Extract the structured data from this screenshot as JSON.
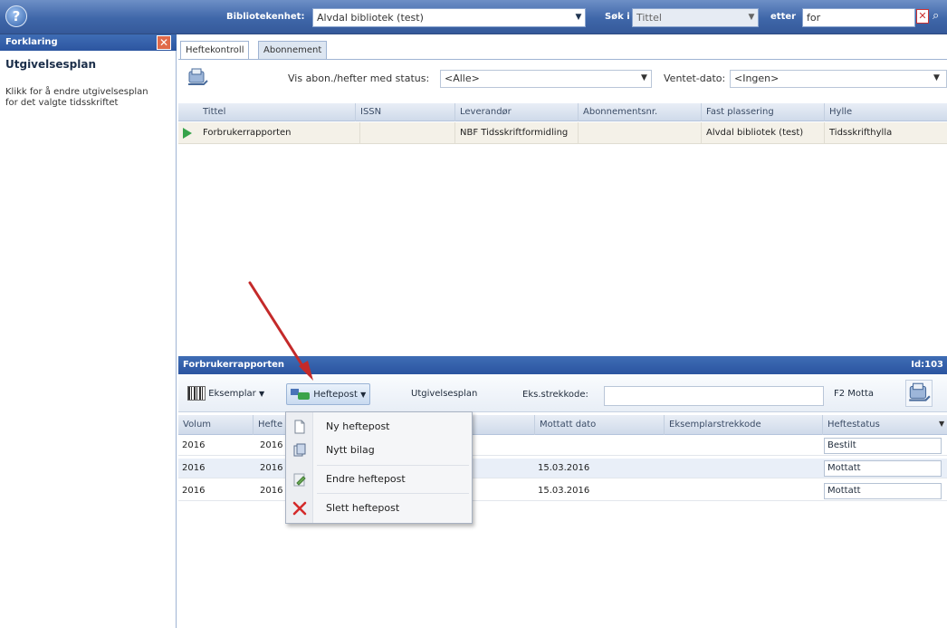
{
  "app": {
    "logo": "?"
  },
  "topbar": {
    "unit_label": "Bibliotekenhet:",
    "unit_value": "Alvdal bibliotek (test)",
    "search_in_label": "Søk i",
    "search_in_value": "Tittel",
    "after_label": "etter",
    "search_value": "for"
  },
  "left_panel": {
    "header": "Forklaring",
    "title": "Utgivelsesplan",
    "description": "Klikk for å endre utgivelsesplan for det valgte tidsskriftet"
  },
  "tabs": [
    {
      "label": "Heftekontroll",
      "active": true
    },
    {
      "label": "Abonnement",
      "active": false
    }
  ],
  "filter": {
    "status_label": "Vis abon./hefter med status:",
    "status_value": "<Alle>",
    "date_label": "Ventet-dato:",
    "date_value": "<Ingen>"
  },
  "grid1": {
    "columns": [
      "Tittel",
      "ISSN",
      "Leverandør",
      "Abonnementsnr.",
      "Fast plassering",
      "Hylle"
    ],
    "rows": [
      [
        "Forbrukerrapporten",
        "",
        "NBF Tidsskriftformidling",
        "",
        "Alvdal bibliotek (test)",
        "Tidsskrifthylla"
      ]
    ]
  },
  "section": {
    "title": "Forbrukerrapporten",
    "id_label": "Id:103"
  },
  "toolbar2": {
    "eksemplar": "Eksemplar",
    "heftepost": "Heftepost",
    "utgivelsesplan": "Utgivelsesplan",
    "barcode_label": "Eks.strekkode:",
    "barcode_value": "",
    "receive": "F2 Motta"
  },
  "grid2": {
    "columns": [
      "Volum",
      "Hefte",
      "Mottatt dato",
      "Eksemplarstrekkode",
      "Heftestatus"
    ],
    "rows": [
      {
        "volum": "2016",
        "hefte": "2016",
        "mottatt": "",
        "strekkode": "",
        "status": "Bestilt"
      },
      {
        "volum": "2016",
        "hefte": "2016",
        "mottatt": "15.03.2016",
        "strekkode": "",
        "status": "Mottatt"
      },
      {
        "volum": "2016",
        "hefte": "2016",
        "mottatt": "15.03.2016",
        "strekkode": "",
        "status": "Mottatt"
      }
    ]
  },
  "menu": {
    "items": [
      {
        "label": "Ny heftepost",
        "icon": "new-document-icon"
      },
      {
        "label": "Nytt bilag",
        "icon": "attachment-icon"
      },
      {
        "label": "Endre heftepost",
        "icon": "edit-icon"
      },
      {
        "label": "Slett heftepost",
        "icon": "delete-icon"
      }
    ]
  },
  "colors": {
    "accent": "#3f6db5",
    "arrow": "#c42a2a",
    "selected_row": "#f4f1e8"
  }
}
